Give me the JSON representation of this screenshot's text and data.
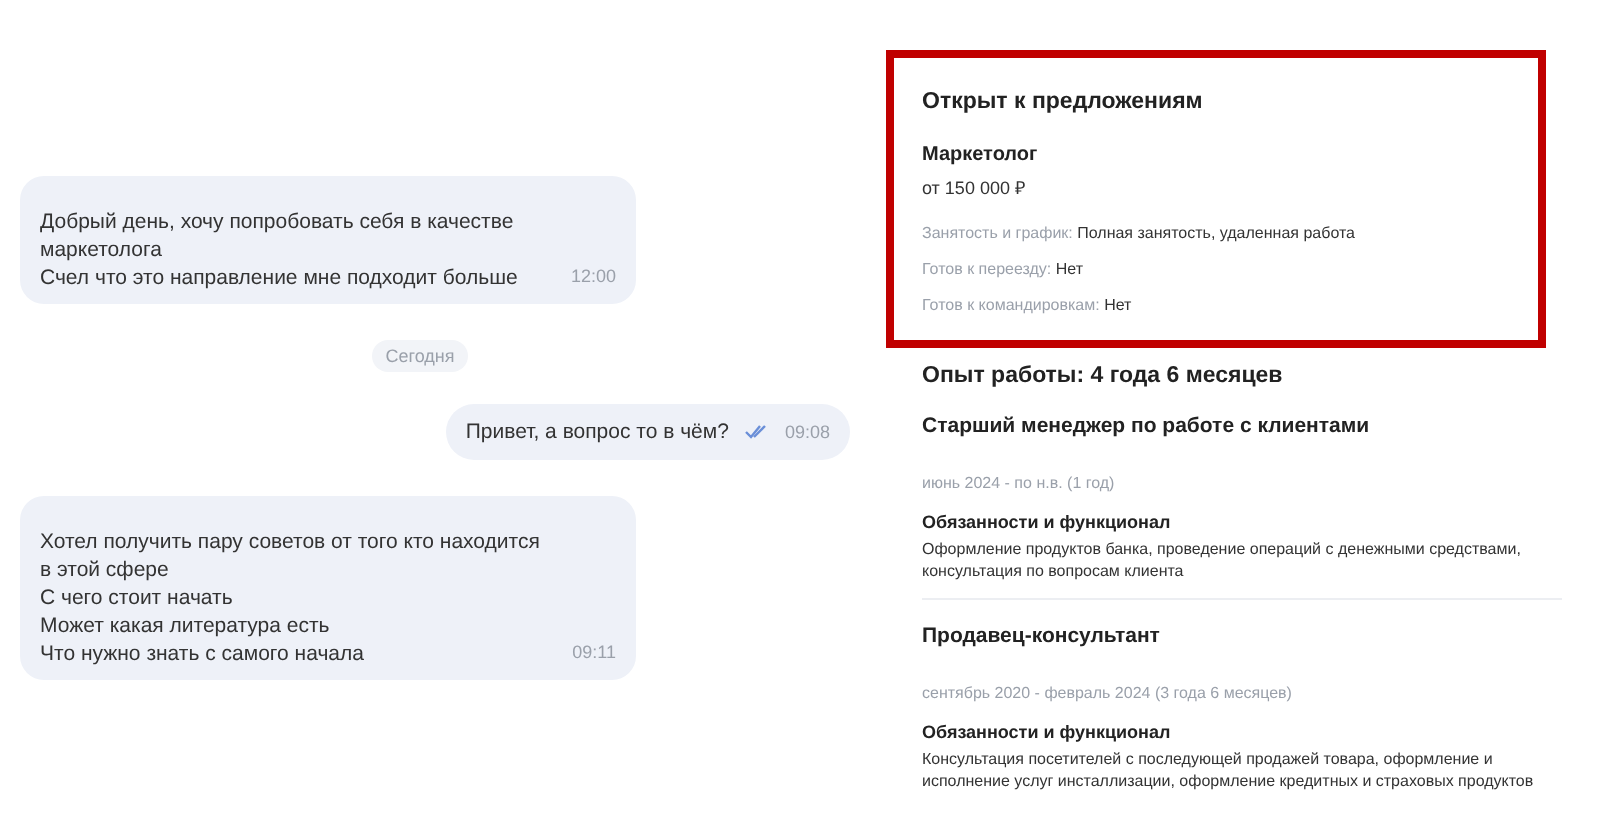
{
  "chat": {
    "messages": [
      {
        "kind": "incoming",
        "lines": [
          "Добрый день, хочу попробовать себя в качестве маркетолога",
          "Счел что это направление мне подходит больше"
        ],
        "time": "12:00"
      },
      {
        "kind": "date",
        "label": "Сегодня"
      },
      {
        "kind": "outgoing",
        "lines": [
          "Привет, а вопрос то в чём?"
        ],
        "time": "09:08",
        "read": true
      },
      {
        "kind": "incoming",
        "lines": [
          "Хотел получить пару советов от того кто находится в этой сфере",
          "С чего стоит начать",
          "Может какая литература есть",
          "Что нужно знать с самого начала"
        ],
        "time": "09:11"
      }
    ]
  },
  "resume": {
    "offer": {
      "title": "Открыт к предложениям",
      "position": "Маркетолог",
      "salary": "от 150 000 ₽",
      "highlighted": true,
      "details": [
        {
          "label": "Занятость и график:",
          "value": "Полная занятость, удаленная работа"
        },
        {
          "label": "Готов к переезду:",
          "value": "Нет"
        },
        {
          "label": "Готов к командировкам:",
          "value": "Нет"
        }
      ]
    },
    "experience_title": "Опыт работы: 4 года 6 месяцев",
    "jobs": [
      {
        "title": "Старший менеджер по работе с клиентами",
        "period": "июнь 2024 - по н.в. (1 год)",
        "duties_title": "Обязанности и функционал",
        "duties": "Оформление продуктов банка, проведение операций с денежными средствами, консультация по вопросам клиента"
      },
      {
        "title": "Продавец-консультант",
        "period": "сентябрь 2020 - февраль 2024 (3 года 6 месяцев)",
        "duties_title": "Обязанности и функционал",
        "duties": "Консультация посетителей с последующей продажей товара, оформление и исполнение услуг инсталлизации, оформление кредитных и страховых продуктов"
      }
    ]
  }
}
